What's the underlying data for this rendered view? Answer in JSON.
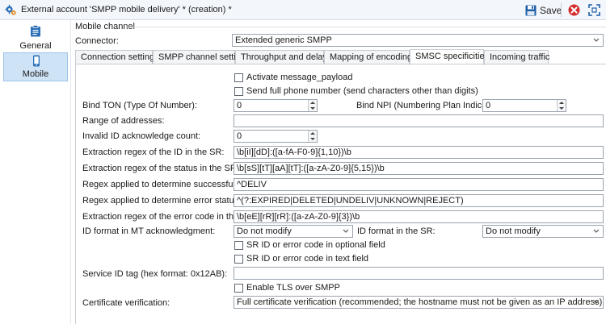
{
  "window": {
    "title": "External account 'SMPP mobile delivery' * (creation) *",
    "save_label": "Save"
  },
  "sidebar": {
    "items": [
      {
        "label": "General",
        "icon": "clipboard-icon"
      },
      {
        "label": "Mobile",
        "icon": "mobile-phone-icon",
        "active": true
      }
    ]
  },
  "section": {
    "title": "Mobile channel",
    "connector_label": "Connector:",
    "connector_value": "Extended generic SMPP"
  },
  "tabs": [
    {
      "label": "Connection settings"
    },
    {
      "label": "SMPP channel settings"
    },
    {
      "label": "Throughput and delays"
    },
    {
      "label": "Mapping of encodings"
    },
    {
      "label": "SMSC specificities",
      "active": true
    },
    {
      "label": "Incoming traffic"
    }
  ],
  "form": {
    "activate_message_payload": "Activate message_payload",
    "send_full_phone": "Send full phone number (send characters other than digits)",
    "bind_ton_label": "Bind TON (Type Of Number):",
    "bind_ton_value": "0",
    "bind_npi_label": "Bind NPI (Numbering Plan Indicator):",
    "bind_npi_value": "0",
    "range_label": "Range of addresses:",
    "range_value": "",
    "invalid_id_label": "Invalid ID acknowledge count:",
    "invalid_id_value": "0",
    "regex_id_label": "Extraction regex of the ID in the SR:",
    "regex_id_value": "\\b[iI][dD]:([a-fA-F0-9]{1,10})\\b",
    "regex_status_label": "Extraction regex of the status in the SR:",
    "regex_status_value": "\\b[sS][tT][aA][tT]:([a-zA-Z0-9]{5,15})\\b",
    "regex_success_label": "Regex applied to determine successful status:",
    "regex_success_value": "^DELIV",
    "regex_error_label": "Regex applied to determine error status:",
    "regex_error_value": "^(?:EXPIRED|DELETED|UNDELIV|UNKNOWN|REJECT)",
    "regex_errcode_label": "Extraction regex of the error code in the SR:",
    "regex_errcode_value": "\\b[eE][rR][rR]:([a-zA-Z0-9]{3})\\b",
    "id_format_mt_label": "ID format in MT acknowledgment:",
    "id_format_mt_value": "Do not modify",
    "id_format_sr_label": "ID format in the SR:",
    "id_format_sr_value": "Do not modify",
    "sr_optional_field": "SR ID or error code in optional field",
    "sr_text_field": "SR ID or error code in text field",
    "service_id_label": "Service ID tag (hex format: 0x12AB):",
    "service_id_value": "",
    "enable_tls": "Enable TLS over SMPP",
    "cert_label": "Certificate verification:",
    "cert_value": "Full certificate verification (recommended; the hostname must not be given as an IP address)"
  }
}
